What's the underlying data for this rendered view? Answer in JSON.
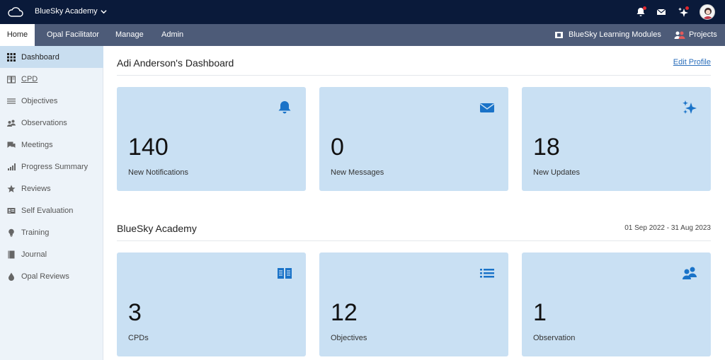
{
  "topbar": {
    "org_name": "BlueSky Academy",
    "icons": [
      "cloud-icon",
      "bell-icon",
      "envelope-icon",
      "sparkle-icon",
      "avatar"
    ]
  },
  "nav": {
    "tabs": [
      {
        "label": "Home",
        "active": true
      },
      {
        "label": "Opal Facilitator",
        "active": false
      },
      {
        "label": "Manage",
        "active": false
      },
      {
        "label": "Admin",
        "active": false
      }
    ],
    "right": [
      {
        "label": "BlueSky Learning Modules",
        "icon": "module-icon"
      },
      {
        "label": "Projects",
        "icon": "users-icon"
      }
    ]
  },
  "sidebar": {
    "items": [
      {
        "label": "Dashboard",
        "icon": "grid-icon",
        "active": true
      },
      {
        "label": "CPD",
        "icon": "book-icon",
        "active": false
      },
      {
        "label": "Objectives",
        "icon": "list-icon",
        "active": false
      },
      {
        "label": "Observations",
        "icon": "people-icon",
        "active": false
      },
      {
        "label": "Meetings",
        "icon": "chat-icon",
        "active": false
      },
      {
        "label": "Progress Summary",
        "icon": "bars-icon",
        "active": false
      },
      {
        "label": "Reviews",
        "icon": "star-icon",
        "active": false
      },
      {
        "label": "Self Evaluation",
        "icon": "id-card-icon",
        "active": false
      },
      {
        "label": "Training",
        "icon": "bulb-icon",
        "active": false
      },
      {
        "label": "Journal",
        "icon": "journal-icon",
        "active": false
      },
      {
        "label": "Opal Reviews",
        "icon": "drop-icon",
        "active": false
      }
    ]
  },
  "main": {
    "dashboard_title": "Adi Anderson's Dashboard",
    "edit_profile": "Edit Profile",
    "summary_cards": [
      {
        "value": "140",
        "label": "New Notifications",
        "icon": "bell-icon"
      },
      {
        "value": "0",
        "label": "New Messages",
        "icon": "envelope-icon"
      },
      {
        "value": "18",
        "label": "New Updates",
        "icon": "sparkle-icon"
      }
    ],
    "academy_title": "BlueSky Academy",
    "date_range": "01 Sep 2022 - 31 Aug 2023",
    "academy_cards": [
      {
        "value": "3",
        "label": "CPDs",
        "icon": "book-icon"
      },
      {
        "value": "12",
        "label": "Objectives",
        "icon": "list-icon"
      },
      {
        "value": "1",
        "label": "Observation",
        "icon": "people-icon"
      }
    ]
  },
  "colors": {
    "topbar": "#0a1a3a",
    "navbar": "#4d5b78",
    "sidebar": "#edf3f9",
    "sidebar_active": "#c9def0",
    "card": "#c9e0f3",
    "accent_icon": "#1a73c8",
    "link": "#2a6ebb"
  }
}
